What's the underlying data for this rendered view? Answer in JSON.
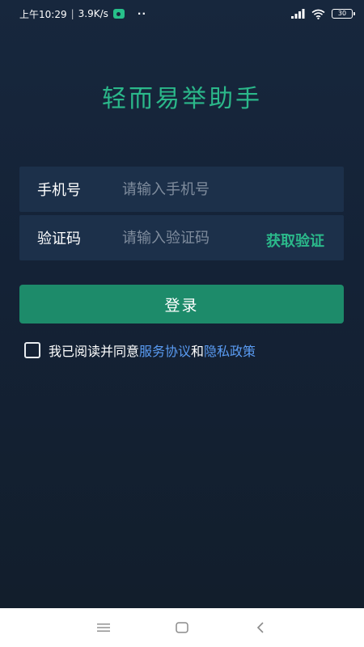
{
  "status_bar": {
    "time": "上午10:29",
    "speed": "3.9K/s",
    "battery": "30"
  },
  "app": {
    "title": "轻而易举助手"
  },
  "form": {
    "phone_label": "手机号",
    "phone_placeholder": "请输入手机号",
    "code_label": "验证码",
    "code_placeholder": "请输入验证码",
    "get_code_label": "获取验证"
  },
  "login": {
    "button_label": "登录"
  },
  "agreement": {
    "prefix": "我已阅读并同意",
    "service_link": "服务协议",
    "conjunction": "和",
    "privacy_link": "隐私政策"
  },
  "colors": {
    "accent": "#2bb88a",
    "button": "#1d8b6a",
    "link": "#5a9bf2",
    "background": "#17273d"
  }
}
